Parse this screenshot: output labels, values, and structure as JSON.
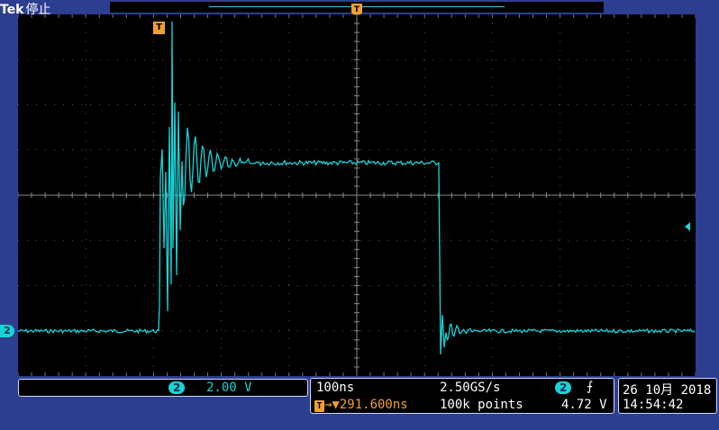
{
  "header": {
    "brand": "Tek",
    "status": "停止"
  },
  "channel": {
    "number": "2",
    "scale": "2.00 V"
  },
  "timebase": {
    "scale": "100ns",
    "sample_rate": "2.50GS/s",
    "points": "100k points",
    "trigger_delay": "291.600ns"
  },
  "trigger": {
    "source": "2",
    "slope_symbol": "⨍",
    "level": "4.72 V",
    "marker_label": "T",
    "pos_label": "T"
  },
  "datetime": {
    "date": "26 10月 2018",
    "time": "14:54:42"
  },
  "colors": {
    "trace": "#17d4d8",
    "trigger": "#f0a030",
    "background": "#2c3e8f",
    "graticule": "#5a5a5a"
  },
  "icons": {
    "trigger_level_arrow": "left-arrow-icon",
    "slope": "rising-edge-icon"
  }
}
